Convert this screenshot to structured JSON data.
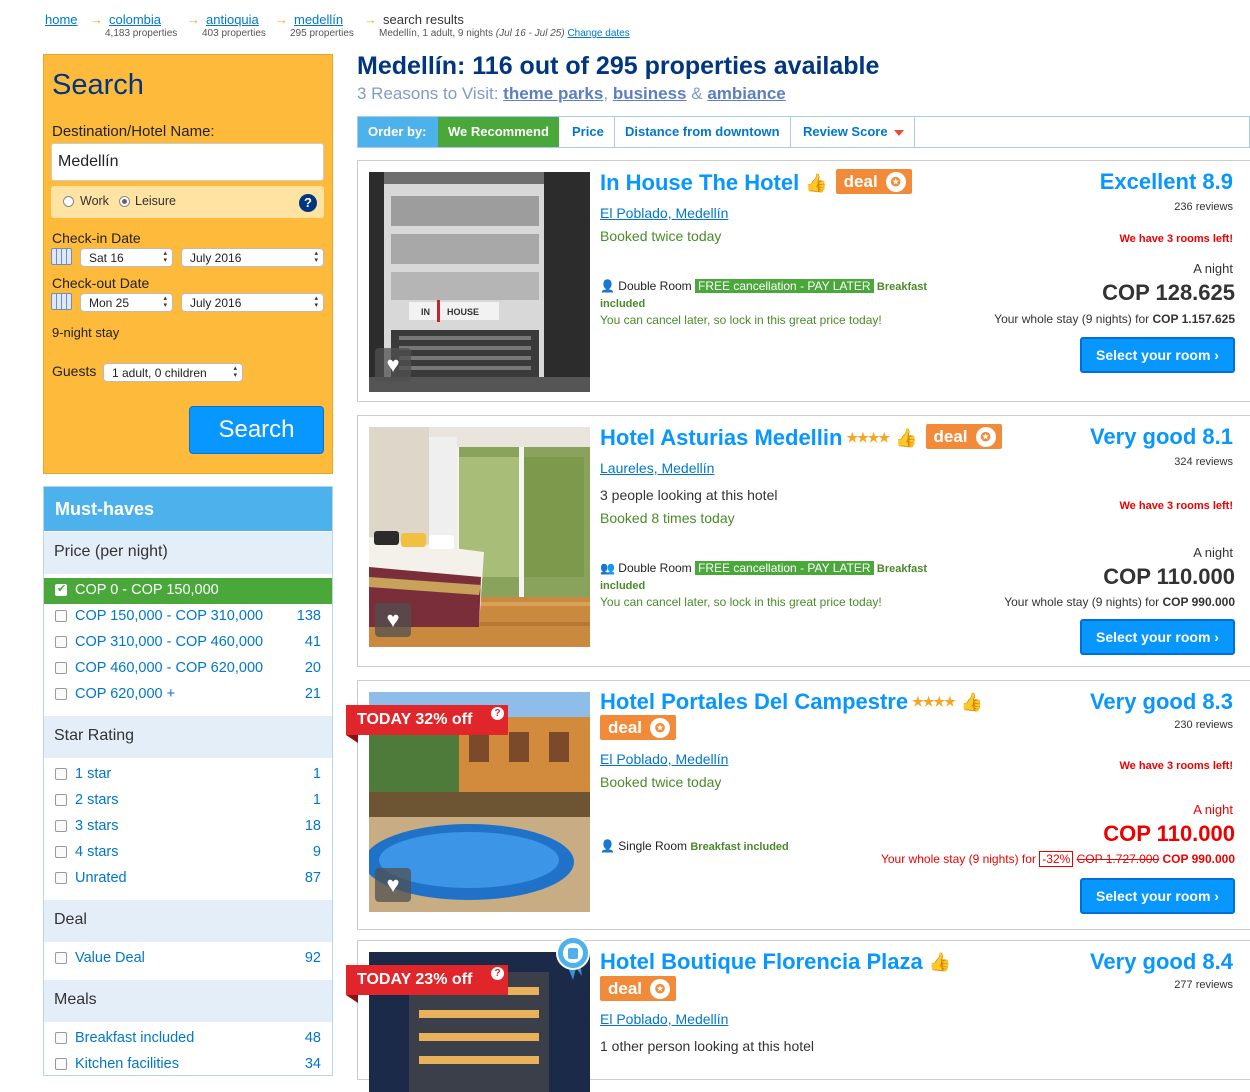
{
  "breadcrumb": {
    "items": [
      {
        "label": "home",
        "sub": ""
      },
      {
        "label": "colombia",
        "sub": "4,183 properties"
      },
      {
        "label": "antioquia",
        "sub": "403 properties"
      },
      {
        "label": "medellín",
        "sub": "295 properties"
      }
    ],
    "current": "search results",
    "current_sub": "Medellín, 1 adult, 9 nights",
    "current_dates": "(Jul 16 - Jul 25)",
    "change_dates": "Change dates"
  },
  "search": {
    "title": "Search",
    "dest_label": "Destination/Hotel Name:",
    "dest_value": "Medellín",
    "work": "Work",
    "leisure": "Leisure",
    "help": "?",
    "checkin_label": "Check-in Date",
    "checkin_day": "Sat 16",
    "checkin_month": "July 2016",
    "checkout_label": "Check-out Date",
    "checkout_day": "Mon 25",
    "checkout_month": "July 2016",
    "stay": "9-night stay",
    "guests_label": "Guests",
    "guests_value": "1 adult, 0 children",
    "button": "Search"
  },
  "filters": {
    "title": "Must-haves",
    "price_title": "Price (per night)",
    "price": [
      {
        "label": "COP 0 - COP 150,000",
        "count": ""
      },
      {
        "label": "COP 150,000 - COP 310,000",
        "count": "138"
      },
      {
        "label": "COP 310,000 - COP 460,000",
        "count": "41"
      },
      {
        "label": "COP 460,000 - COP 620,000",
        "count": "20"
      },
      {
        "label": "COP 620,000 +",
        "count": "21"
      }
    ],
    "star_title": "Star Rating",
    "stars": [
      {
        "label": "1 star",
        "count": "1"
      },
      {
        "label": "2 stars",
        "count": "1"
      },
      {
        "label": "3 stars",
        "count": "18"
      },
      {
        "label": "4 stars",
        "count": "9"
      },
      {
        "label": "Unrated",
        "count": "87"
      }
    ],
    "deal_title": "Deal",
    "deal": {
      "label": "Value Deal",
      "count": "92"
    },
    "meals_title": "Meals",
    "meals": [
      {
        "label": "Breakfast included",
        "count": "48"
      },
      {
        "label": "Kitchen facilities",
        "count": "34"
      }
    ]
  },
  "main": {
    "title": "Medellín: 116 out of 295 properties available",
    "reasons_prefix": "3 Reasons to Visit:",
    "reason1": "theme parks",
    "sep1": ",",
    "reason2": "business",
    "sep2": "&",
    "reason3": "ambiance",
    "order_label": "Order by:",
    "order": [
      "We Recommend",
      "Price",
      "Distance from downtown",
      "Review Score"
    ]
  },
  "hotels": [
    {
      "name": "In House The Hotel",
      "stars": "",
      "deal": "deal",
      "location": "El Poblado, Medellín",
      "line1": "Booked twice today",
      "line2": "",
      "room": "Double Room",
      "free": "FREE cancellation - PAY LATER",
      "breakfast": "Breakfast included",
      "cancel": "You can cancel later, so lock in this great price today!",
      "score": "Excellent 8.9",
      "reviews": "236 reviews",
      "rooms_left": "We have 3 rooms left!",
      "night": "A night",
      "price": "COP 128.625",
      "whole": "Your whole stay (9 nights) for",
      "whole_price": "COP 1.157.625",
      "select": "Select your room ›"
    },
    {
      "name": "Hotel Asturias Medellin",
      "stars": "★★★★",
      "deal": "deal",
      "location": "Laureles, Medellín",
      "line1": "3 people looking at this hotel",
      "line2": "Booked 8 times today",
      "room": "Double Room",
      "free": "FREE cancellation - PAY LATER",
      "breakfast": "Breakfast included",
      "cancel": "You can cancel later, so lock in this great price today!",
      "score": "Very good 8.1",
      "reviews": "324 reviews",
      "rooms_left": "We have 3 rooms left!",
      "night": "A night",
      "price": "COP 110.000",
      "whole": "Your whole stay (9 nights) for",
      "whole_price": "COP 990.000",
      "select": "Select your room ›"
    },
    {
      "name": "Hotel Portales Del Campestre",
      "stars": "★★★★",
      "deal": "deal",
      "ribbon": "TODAY 32% off",
      "location": "El Poblado, Medellín",
      "line1": "Booked twice today",
      "room": "Single Room",
      "breakfast": "Breakfast included",
      "score": "Very good 8.3",
      "reviews": "230 reviews",
      "rooms_left": "We have 3 rooms left!",
      "night": "A night",
      "price": "COP 110.000",
      "whole": "Your whole stay (9 nights) for",
      "discount": "-32%",
      "old_price": "COP 1.727.000",
      "whole_price": "COP 990.000",
      "select": "Select your room ›"
    },
    {
      "name": "Hotel Boutique Florencia Plaza",
      "deal": "deal",
      "ribbon": "TODAY 23% off",
      "location": "El Poblado, Medellín",
      "line1": "1 other person looking at this hotel",
      "score": "Very good 8.4",
      "reviews": "277 reviews"
    }
  ],
  "colors": {
    "brand": "#003580",
    "accent": "#0896ff",
    "search_bg": "#febb3b",
    "green": "#4aa83b",
    "deal": "#f18b3a",
    "ribbon": "#e0262a"
  },
  "icons": [
    "calendar-icon",
    "help-icon",
    "heart-icon",
    "thumbs-up-icon",
    "deal-icon",
    "person-icon",
    "sort-arrow-icon",
    "award-badge-icon"
  ]
}
